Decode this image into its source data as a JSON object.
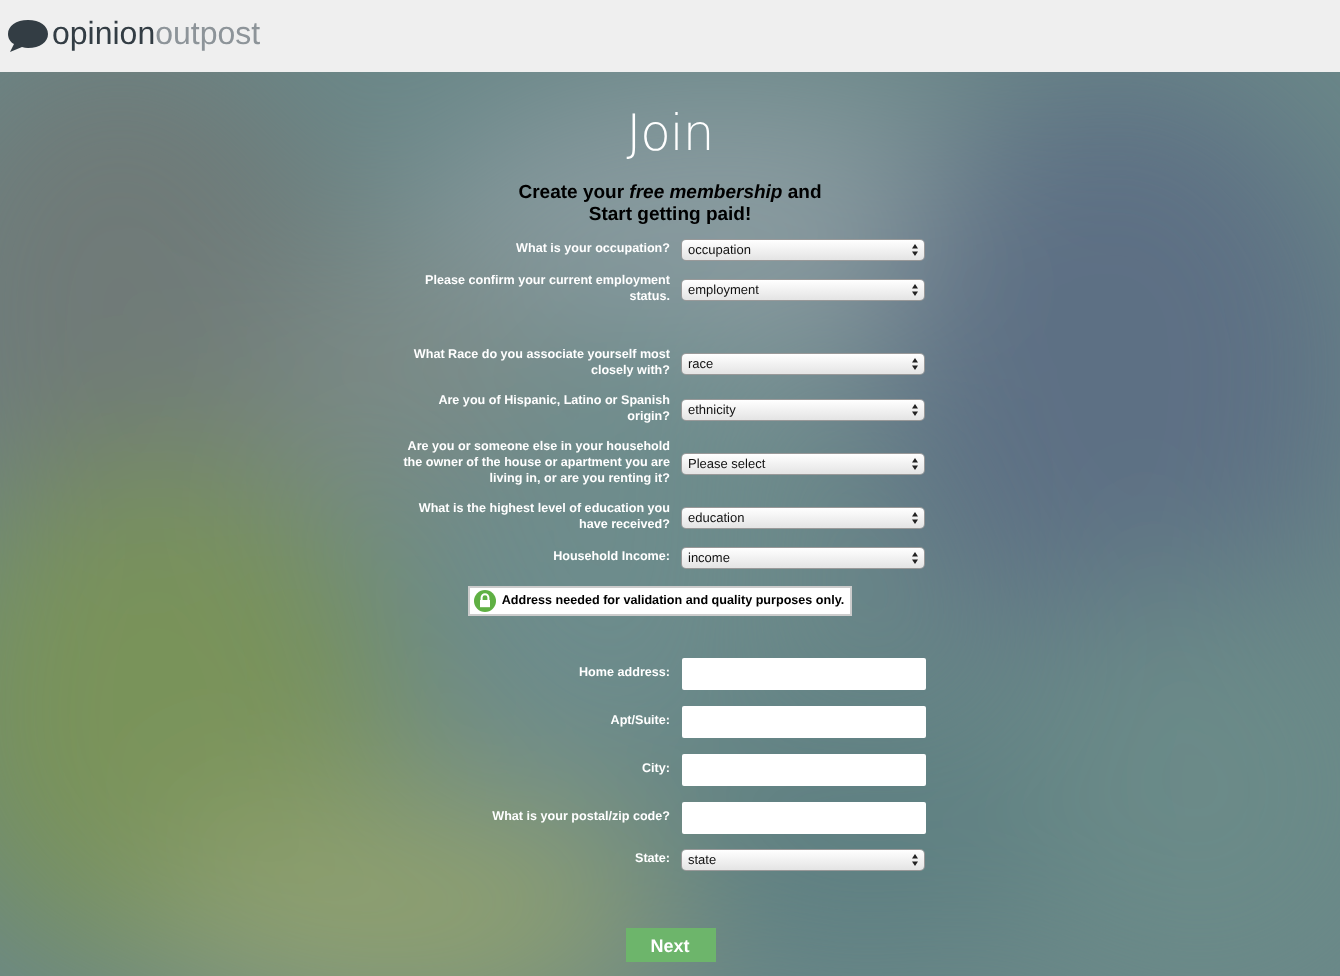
{
  "header": {
    "logo": {
      "word_1": "opinion",
      "word_2": "outpost"
    }
  },
  "title": "Join",
  "heading": [
    "Create your *free membership* and",
    "Start getting paid!"
  ],
  "questions": [
    {
      "kind": "select",
      "label": "What is your occupation?",
      "value": "occupation"
    },
    {
      "kind": "select",
      "label": "Please confirm your current employment status.",
      "value": "employment"
    },
    {
      "kind": "select",
      "label": "What Race do you associate yourself most closely with?",
      "value": "race"
    },
    {
      "kind": "select",
      "label": "Are you of Hispanic, Latino or Spanish origin?",
      "value": "ethnicity"
    },
    {
      "kind": "select",
      "label": "Are you or someone else in your household the owner of the house or apartment you are living in, or are you renting it?",
      "value": "Please select"
    },
    {
      "kind": "select",
      "label": "What is the highest level of education you have received?",
      "value": "education"
    },
    {
      "kind": "select",
      "label": "Household Income:",
      "value": "income"
    }
  ],
  "notice": "Address needed for validation and quality purposes only.",
  "address_fields": [
    {
      "kind": "text",
      "label": "Home address:"
    },
    {
      "kind": "text",
      "label": "Apt/Suite:"
    },
    {
      "kind": "text",
      "label": "City:"
    },
    {
      "kind": "text",
      "label": "What is your postal/zip code?"
    },
    {
      "kind": "select",
      "label": "State:",
      "value": "state"
    }
  ],
  "button": "Next"
}
